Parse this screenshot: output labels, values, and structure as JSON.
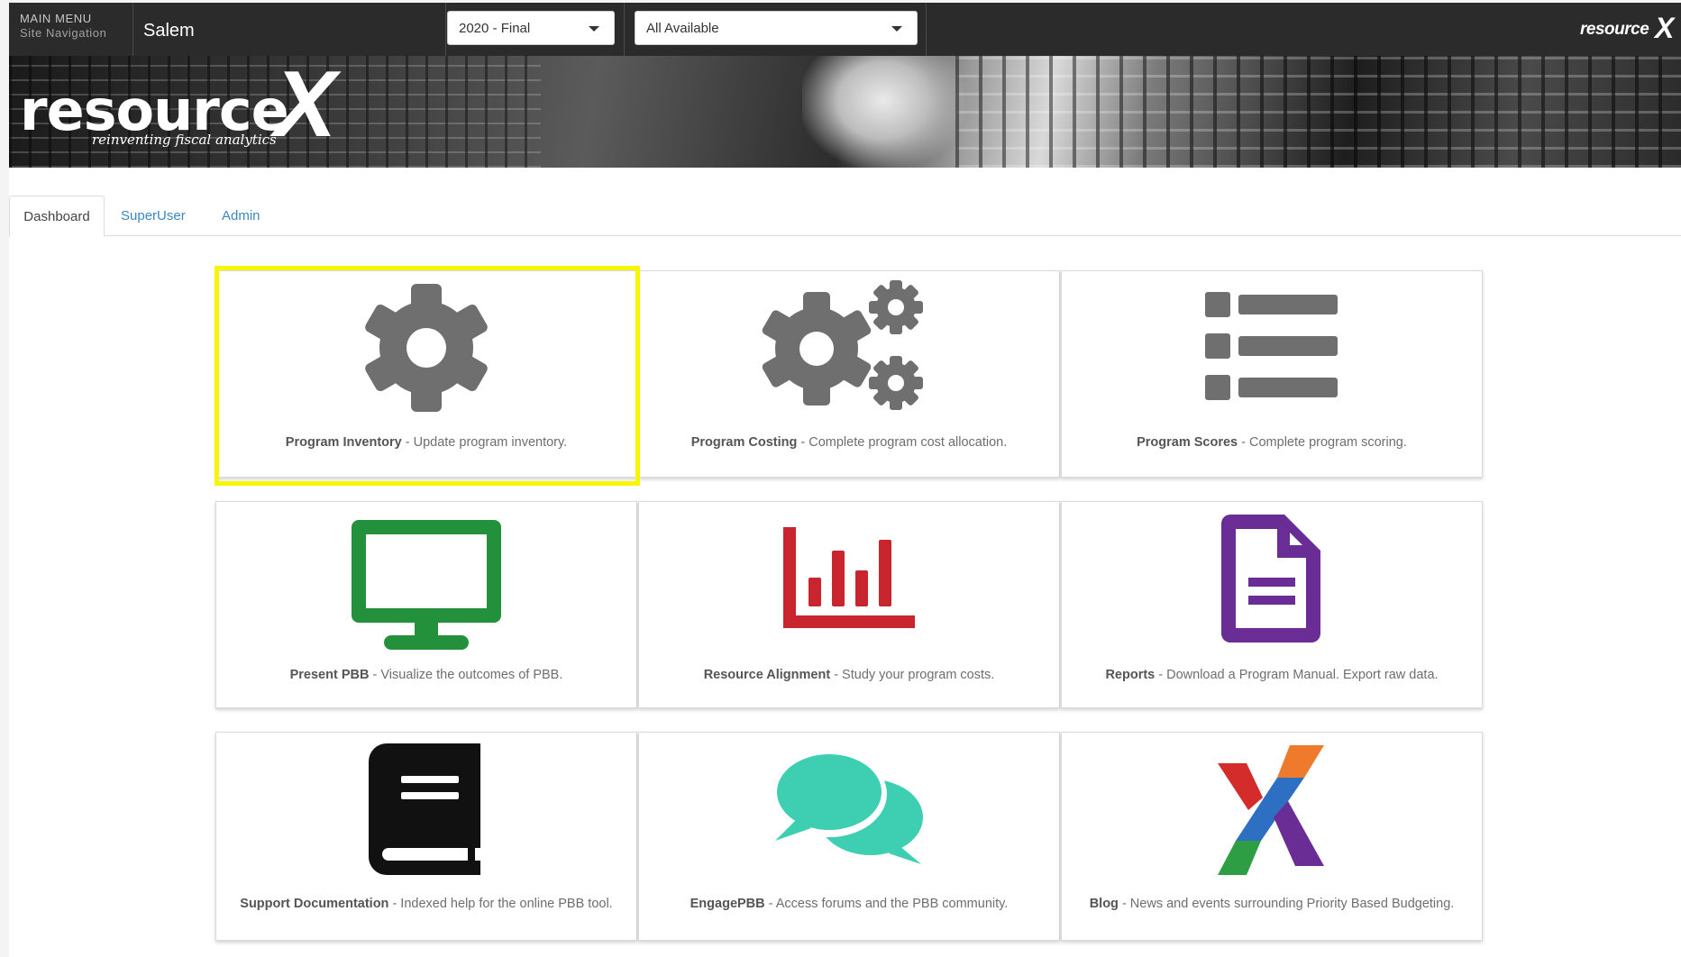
{
  "navbar": {
    "menu_line1": "MAIN MENU",
    "menu_line2": "Site Navigation",
    "site_name": "Salem",
    "year_select": "2020 - Final",
    "scope_select": "All Available",
    "brand": "resource",
    "brand_x": "X"
  },
  "banner": {
    "logo_word": "resource",
    "logo_x": "X",
    "tagline": "reinventing fiscal analytics"
  },
  "tabs": [
    {
      "label": "Dashboard",
      "active": true
    },
    {
      "label": "SuperUser",
      "active": false
    },
    {
      "label": "Admin",
      "active": false
    }
  ],
  "tiles": [
    {
      "title": "Program Inventory",
      "desc": " - Update program inventory.",
      "icon": "gear-icon",
      "color": "#6f6f6f",
      "highlighted": true
    },
    {
      "title": "Program Costing",
      "desc": " - Complete program cost allocation.",
      "icon": "gears-icon",
      "color": "#6f6f6f"
    },
    {
      "title": "Program Scores",
      "desc": " - Complete program scoring.",
      "icon": "list-icon",
      "color": "#6f6f6f"
    },
    {
      "title": "Present PBB",
      "desc": " - Visualize the outcomes of PBB.",
      "icon": "monitor-icon",
      "color": "#23913c"
    },
    {
      "title": "Resource Alignment",
      "desc": " - Study your program costs.",
      "icon": "bar-chart-icon",
      "color": "#c8252f"
    },
    {
      "title": "Reports",
      "desc": " - Download a Program Manual. Export raw data.",
      "icon": "document-icon",
      "color": "#6a2d96"
    },
    {
      "title": "Support Documentation",
      "desc": " - Indexed help for the online PBB tool.",
      "icon": "book-icon",
      "color": "#111111"
    },
    {
      "title": "EngagePBB",
      "desc": " - Access forums and the PBB community.",
      "icon": "chat-bubbles-icon",
      "color": "#3ecfb3"
    },
    {
      "title": "Blog",
      "desc": " - News and events surrounding Priority Based Budgeting.",
      "icon": "resourcex-x-icon",
      "color": "#d42b2b"
    }
  ]
}
